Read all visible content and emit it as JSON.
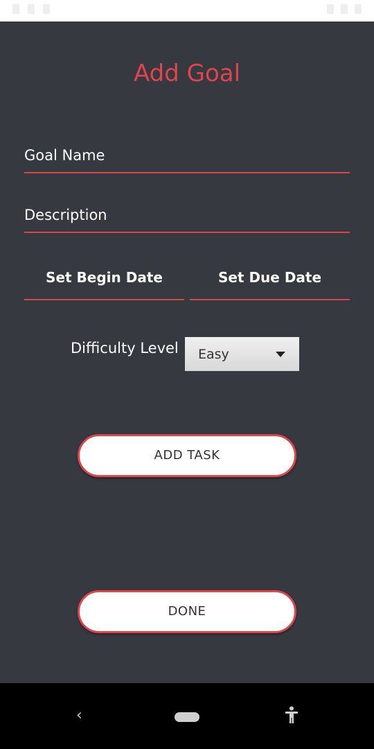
{
  "colors": {
    "background": "#363940",
    "accent": "#e0454c",
    "text": "#ffffff"
  },
  "page": {
    "title": "Add Goal"
  },
  "form": {
    "goal_name_placeholder": "Goal Name",
    "description_placeholder": "Description",
    "begin_date_label": "Set Begin Date",
    "due_date_label": "Set Due Date",
    "difficulty_label": "Difficulty Level",
    "difficulty_selected": "Easy"
  },
  "buttons": {
    "add_task": "ADD TASK",
    "done": "DONE"
  },
  "nav": {
    "back_glyph": "‹"
  }
}
